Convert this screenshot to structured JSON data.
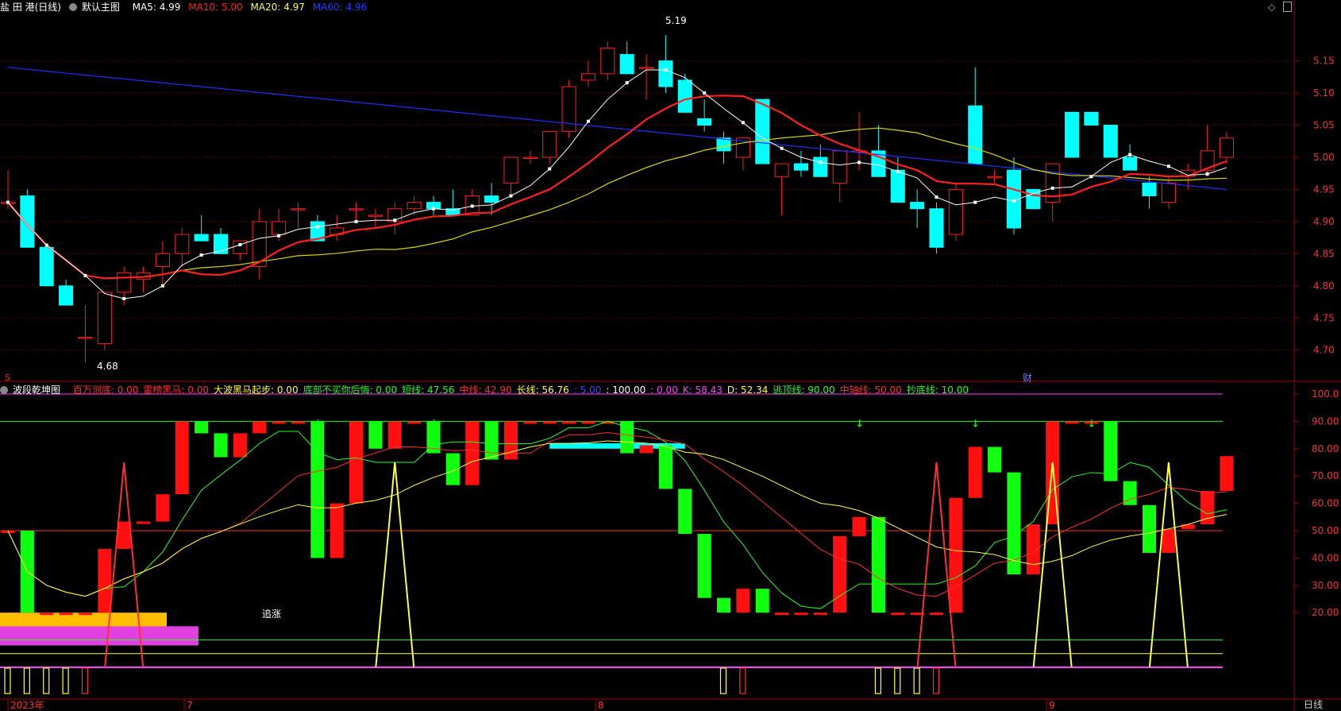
{
  "top_header": {
    "stock": "盐 田 港(日线)",
    "indicator": "默认主图",
    "ma": [
      {
        "label": "MA5: 4.99",
        "color": "#ffffff"
      },
      {
        "label": "MA10: 5.00",
        "color": "#ff2020"
      },
      {
        "label": "MA20: 4.97",
        "color": "#ffff40"
      },
      {
        "label": "MA60: 4.96",
        "color": "#2040ff"
      }
    ]
  },
  "bottom_header": {
    "indicator": "波段乾坤图",
    "items": [
      {
        "label": "百万测底: 0.00",
        "color": "#ff3030"
      },
      {
        "label": "雷榜黑马: 0.00",
        "color": "#ff3030"
      },
      {
        "label": "大波黑马起步: 0.00",
        "color": "#ffff40"
      },
      {
        "label": "底部不买你后悔: 0.00",
        "color": "#20ff20"
      },
      {
        "label": "短线: 47.56",
        "color": "#20ff20"
      },
      {
        "label": "中线: 42.90",
        "color": "#ff3030"
      },
      {
        "label": "长线: 56.76",
        "color": "#ffff40"
      },
      {
        "label": ": 5.00",
        "color": "#3050ff"
      },
      {
        "label": ": 100.00",
        "color": "#ffffff"
      },
      {
        "label": ": 0.00",
        "color": "#ff40ff"
      },
      {
        "label": "K: 58.43",
        "color": "#ff40ff"
      },
      {
        "label": "D: 52.34",
        "color": "#ffff40"
      },
      {
        "label": "逃顶线: 90.00",
        "color": "#20ff20"
      },
      {
        "label": "中轴线: 50.00",
        "color": "#ff3030"
      },
      {
        "label": "抄底线: 10.00",
        "color": "#20ff20"
      }
    ]
  },
  "price_axis": [
    "5.15",
    "5.10",
    "5.05",
    "5.00",
    "4.95",
    "4.90",
    "4.85",
    "4.80",
    "4.75",
    "4.70"
  ],
  "osc_axis": [
    "100.0",
    "90.00",
    "80.00",
    "70.00",
    "60.00",
    "50.00",
    "40.00",
    "30.00",
    "20.00"
  ],
  "date_axis": [
    "2023年",
    "7",
    "8",
    "9"
  ],
  "period_label": "日线",
  "annotations": {
    "high": "5.19",
    "low": "4.68",
    "chase": "追涨",
    "finance": "财",
    "s_marker": "S"
  },
  "chart_data": {
    "type": "candlestick",
    "ylim": [
      4.67,
      5.22
    ],
    "candles": [
      [
        4.93,
        4.98,
        4.92,
        4.93
      ],
      [
        4.94,
        4.95,
        4.86,
        4.86
      ],
      [
        4.86,
        4.86,
        4.8,
        4.8
      ],
      [
        4.8,
        4.81,
        4.77,
        4.77
      ],
      [
        4.72,
        4.77,
        4.68,
        4.72
      ],
      [
        4.71,
        4.79,
        4.7,
        4.79
      ],
      [
        4.79,
        4.83,
        4.77,
        4.82
      ],
      [
        4.81,
        4.83,
        4.79,
        4.82
      ],
      [
        4.83,
        4.87,
        4.8,
        4.85
      ],
      [
        4.85,
        4.89,
        4.83,
        4.88
      ],
      [
        4.88,
        4.91,
        4.87,
        4.87
      ],
      [
        4.88,
        4.89,
        4.85,
        4.85
      ],
      [
        4.85,
        4.86,
        4.84,
        4.87
      ],
      [
        4.83,
        4.92,
        4.81,
        4.9
      ],
      [
        4.88,
        4.92,
        4.87,
        4.9
      ],
      [
        4.92,
        4.93,
        4.89,
        4.92
      ],
      [
        4.9,
        4.91,
        4.87,
        4.87
      ],
      [
        4.88,
        4.91,
        4.87,
        4.89
      ],
      [
        4.92,
        4.93,
        4.9,
        4.92
      ],
      [
        4.91,
        4.92,
        4.89,
        4.91
      ],
      [
        4.9,
        4.93,
        4.88,
        4.92
      ],
      [
        4.92,
        4.94,
        4.91,
        4.93
      ],
      [
        4.93,
        4.94,
        4.91,
        4.92
      ],
      [
        4.92,
        4.95,
        4.91,
        4.91
      ],
      [
        4.91,
        4.95,
        4.91,
        4.94
      ],
      [
        4.94,
        4.96,
        4.91,
        4.93
      ],
      [
        4.96,
        5.0,
        4.94,
        5.0
      ],
      [
        5.0,
        5.01,
        4.99,
        5.0
      ],
      [
        5.0,
        5.03,
        4.99,
        5.04
      ],
      [
        5.04,
        5.12,
        5.03,
        5.11
      ],
      [
        5.12,
        5.15,
        5.11,
        5.13
      ],
      [
        5.13,
        5.18,
        5.12,
        5.17
      ],
      [
        5.16,
        5.18,
        5.13,
        5.13
      ],
      [
        5.14,
        5.16,
        5.09,
        5.14
      ],
      [
        5.15,
        5.19,
        5.1,
        5.11
      ],
      [
        5.12,
        5.13,
        5.07,
        5.07
      ],
      [
        5.06,
        5.09,
        5.04,
        5.05
      ],
      [
        5.03,
        5.04,
        4.99,
        5.01
      ],
      [
        5.0,
        5.03,
        4.98,
        5.03
      ],
      [
        5.09,
        5.09,
        4.99,
        4.99
      ],
      [
        4.97,
        4.99,
        4.91,
        4.99
      ],
      [
        4.99,
        5.01,
        4.97,
        4.98
      ],
      [
        5.0,
        5.02,
        4.97,
        4.97
      ],
      [
        4.96,
        5.01,
        4.93,
        5.01
      ],
      [
        5.01,
        5.07,
        4.98,
        5.01
      ],
      [
        5.01,
        5.05,
        4.97,
        4.97
      ],
      [
        4.98,
        5.0,
        4.94,
        4.93
      ],
      [
        4.93,
        4.95,
        4.89,
        4.92
      ],
      [
        4.92,
        4.93,
        4.85,
        4.86
      ],
      [
        4.88,
        4.96,
        4.87,
        4.95
      ],
      [
        5.08,
        5.14,
        4.99,
        4.99
      ],
      [
        4.97,
        4.98,
        4.96,
        4.97
      ],
      [
        4.98,
        5.0,
        4.88,
        4.89
      ],
      [
        4.95,
        4.95,
        4.92,
        4.92
      ],
      [
        4.93,
        4.98,
        4.9,
        4.99
      ],
      [
        5.07,
        5.07,
        5.0,
        5.0
      ],
      [
        5.07,
        5.07,
        5.05,
        5.05
      ],
      [
        5.05,
        5.05,
        5.0,
        5.0
      ],
      [
        5.0,
        5.02,
        4.98,
        4.98
      ],
      [
        4.96,
        4.97,
        4.92,
        4.94
      ],
      [
        4.93,
        4.97,
        4.92,
        4.96
      ],
      [
        4.97,
        4.99,
        4.95,
        4.98
      ],
      [
        4.98,
        5.05,
        4.97,
        5.01
      ],
      [
        5.0,
        5.04,
        4.99,
        5.03
      ]
    ]
  },
  "colors": {
    "up": "#ff2020",
    "down": "#00ffff",
    "grid": "#5a0000",
    "axis_text": "#ff3030"
  }
}
